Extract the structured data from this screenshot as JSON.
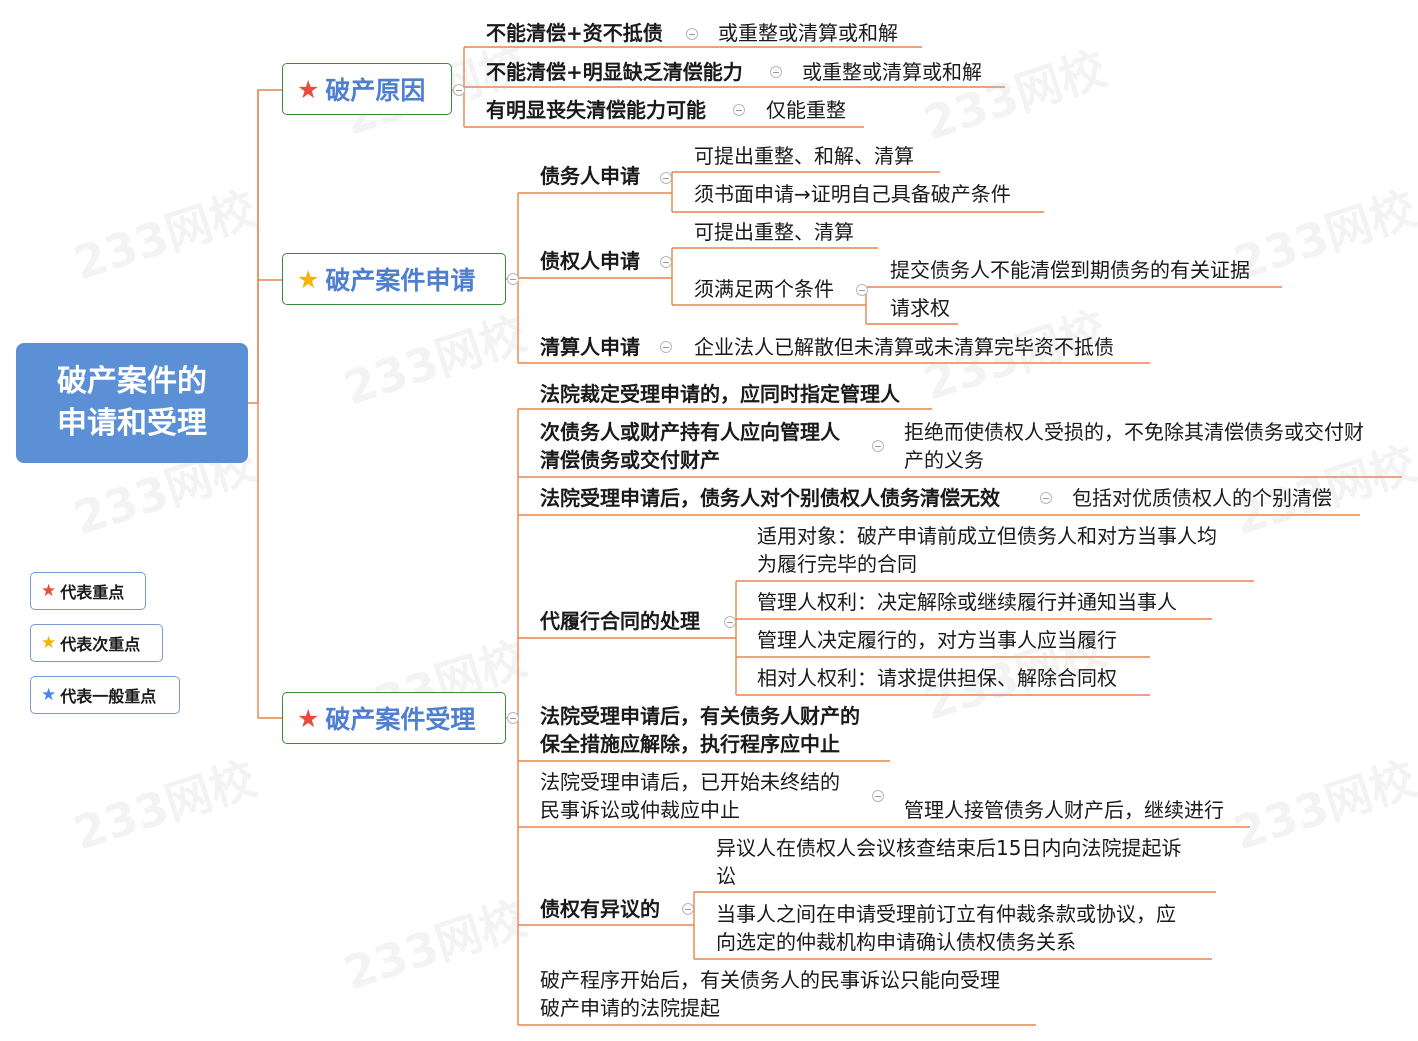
{
  "root": {
    "line1": "破产案件的",
    "line2": "申请和受理"
  },
  "colors": {
    "red_star": "#e74c3c",
    "yellow_star": "#f2b600",
    "blue_star": "#4a86e8",
    "branch_line": "#e8834a",
    "root_fill": "#5b8fd6"
  },
  "topics": {
    "reason": "破产原因",
    "apply": "破产案件申请",
    "accept": "破产案件受理"
  },
  "reason": {
    "r1": "不能清偿+资不抵债",
    "r1_result": "或重整或清算或和解",
    "r2": "不能清偿+明显缺乏清偿能力",
    "r2_result": "或重整或清算或和解",
    "r3": "有明显丧失清偿能力可能",
    "r3_result": "仅能重整"
  },
  "apply": {
    "debtor": "债务人申请",
    "debtor_c1": "可提出重整、和解、清算",
    "debtor_c2": "须书面申请→证明自己具备破产条件",
    "creditor": "债权人申请",
    "creditor_c1": "可提出重整、清算",
    "creditor_c2": "须满足两个条件",
    "creditor_c2_a": "提交债务人不能清偿到期债务的有关证据",
    "creditor_c2_b": "请求权",
    "liquidator": "清算人申请",
    "liquidator_c1": "企业法人已解散但未清算或未清算完毕资不抵债"
  },
  "accept": {
    "a1": "法院裁定受理申请的，应同时指定管理人",
    "a2_l1": "次债务人或财产持有人应向管理人",
    "a2_l2": "清偿债务或交付财产",
    "a2_r_l1": "拒绝而使债权人受损的，不免除其清偿债务或交付财",
    "a2_r_l2": "产的义务",
    "a3": "法院受理申请后，债务人对个别债权人债务清偿无效",
    "a3_r": "包括对优质债权人的个别清偿",
    "a4": "代履行合同的处理",
    "a4_c1_l1": "适用对象：破产申请前成立但债务人和对方当事人均",
    "a4_c1_l2": "为履行完毕的合同",
    "a4_c2": "管理人权利：决定解除或继续履行并通知当事人",
    "a4_c3": "管理人决定履行的，对方当事人应当履行",
    "a4_c4": "相对人权利：请求提供担保、解除合同权",
    "a5_l1": "法院受理申请后，有关债务人财产的",
    "a5_l2": "保全措施应解除，执行程序应中止",
    "a6_l1": "法院受理申请后，已开始未终结的",
    "a6_l2": "民事诉讼或仲裁应中止",
    "a6_r": "管理人接管债务人财产后，继续进行",
    "a7": "债权有异议的",
    "a7_c1_l1": "异议人在债权人会议核查结束后15日内向法院提起诉",
    "a7_c1_l2": "讼",
    "a7_c2_l1": "当事人之间在申请受理前订立有仲裁条款或协议，应",
    "a7_c2_l2": "向选定的仲裁机构申请确认债权债务关系",
    "a8_l1": "破产程序开始后，有关债务人的民事诉讼只能向受理",
    "a8_l2": "破产申请的法院提起"
  },
  "legend": {
    "red": "代表重点",
    "yellow": "代表次重点",
    "blue": "代表一般重点"
  },
  "watermark": "233网校"
}
